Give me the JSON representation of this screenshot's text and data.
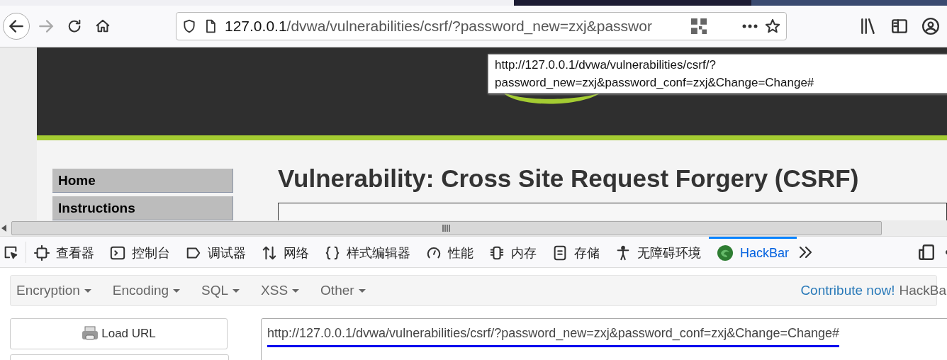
{
  "browser": {
    "url_host": "127.0.0.1",
    "url_path": "/dvwa/vulnerabilities/csrf/?password_new=zxj&passwor",
    "tooltip": "http://127.0.0.1/dvwa/vulnerabilities/csrf/?password_new=zxj&password_conf=zxj&Change=Change#"
  },
  "page": {
    "menu": [
      {
        "label": "Home",
        "selected": false
      },
      {
        "label": "Instructions",
        "selected": false
      }
    ],
    "heading": "Vulnerability: Cross Site Request Forgery (CSRF)"
  },
  "devtools": {
    "tabs": [
      {
        "label": "查看器",
        "kind": "inspector",
        "selected": false
      },
      {
        "label": "控制台",
        "kind": "console",
        "selected": false
      },
      {
        "label": "调试器",
        "kind": "debugger",
        "selected": false
      },
      {
        "label": "网络",
        "kind": "network",
        "selected": false
      },
      {
        "label": "样式编辑器",
        "kind": "style",
        "selected": false
      },
      {
        "label": "性能",
        "kind": "performance",
        "selected": false
      },
      {
        "label": "内存",
        "kind": "memory",
        "selected": false
      },
      {
        "label": "存储",
        "kind": "storage",
        "selected": false
      },
      {
        "label": "无障碍环境",
        "kind": "accessibility",
        "selected": false
      },
      {
        "label": "HackBar",
        "kind": "hackbar",
        "selected": true
      }
    ]
  },
  "hackbar": {
    "menus": [
      "Encryption",
      "Encoding",
      "SQL",
      "XSS",
      "Other"
    ],
    "contribute_link": "Contribute now!",
    "brand": "HackBa",
    "load_button": "Load URL",
    "url_value": "http://127.0.0.1/dvwa/vulnerabilities/csrf/?password_new=zxj&password_conf=zxj&Change=Change#"
  }
}
